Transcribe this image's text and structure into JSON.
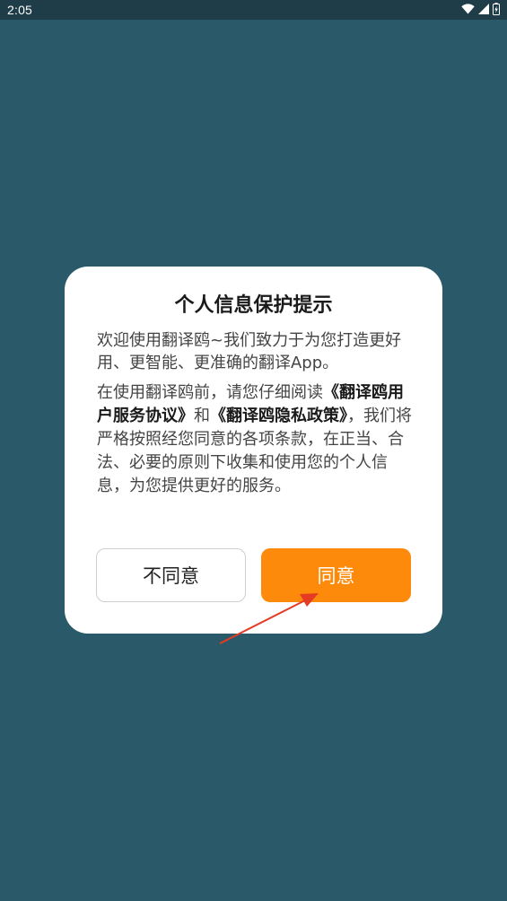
{
  "status_bar": {
    "time": "2:05",
    "icons": [
      "wifi-icon",
      "cellular-signal-icon",
      "battery-icon"
    ]
  },
  "dialog": {
    "title": "个人信息保护提示",
    "intro": "欢迎使用翻译鸥~我们致力于为您打造更好用、更智能、更准确的翻译App。",
    "body_part1": "在使用翻译鸥前，请您仔细阅读",
    "user_agreement_link": "《翻译鸥用户服务协议》",
    "body_part2": "和",
    "privacy_policy_link": "《翻译鸥隐私政策》",
    "body_part3": "，我们将严格按照经您同意的各项条款，在正当、合法、必要的原则下收集和使用您的个人信息，为您提供更好的服务。",
    "disagree_label": "不同意",
    "agree_label": "同意"
  },
  "colors": {
    "background": "#2a5a69",
    "status_bar": "#1f3d48",
    "accent": "#fd8a0a",
    "annotation_arrow": "#e53a24"
  }
}
